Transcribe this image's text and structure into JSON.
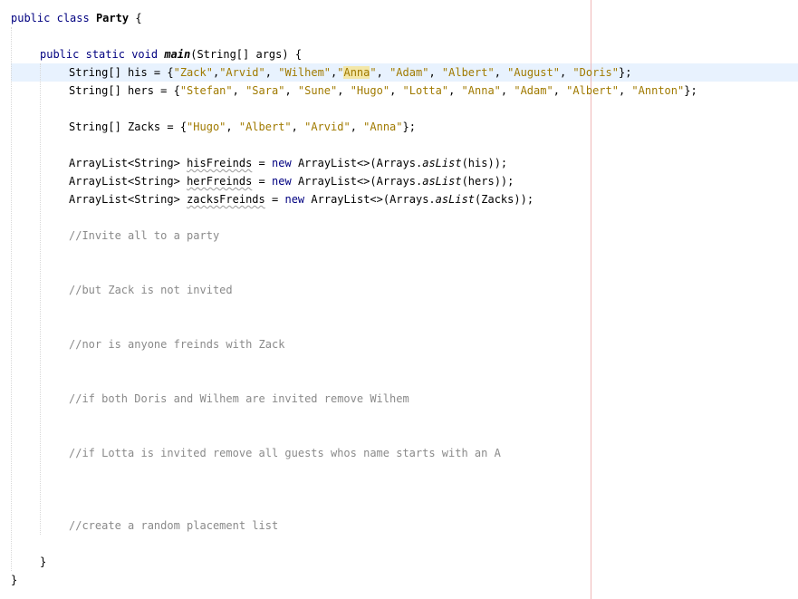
{
  "code": {
    "class_line": {
      "kw1": "public",
      "kw2": "class",
      "class_name": "Party",
      "open_brace": "{"
    },
    "main_line": {
      "kw_public": "public",
      "kw_static": "static",
      "kw_void": "void",
      "method_name": "main",
      "params": "(String[] args) {"
    },
    "his_line": {
      "decl": "String[] his = {",
      "items": [
        "\"Zack\"",
        "\"Arvid\"",
        "\"Wilhem\"",
        "\"Anna\"",
        "\"Adam\"",
        "\"Albert\"",
        "\"August\"",
        "\"Doris\""
      ],
      "close": "};"
    },
    "hers_line": {
      "decl": "String[] hers = {",
      "items": [
        "\"Stefan\"",
        "\"Sara\"",
        "\"Sune\"",
        "\"Hugo\"",
        "\"Lotta\"",
        "\"Anna\"",
        "\"Adam\"",
        "\"Albert\"",
        "\"Annton\""
      ],
      "close": "};"
    },
    "zacks_line": {
      "decl": "String[] Zacks = {",
      "items": [
        "\"Hugo\"",
        "\"Albert\"",
        "\"Arvid\"",
        "\"Anna\""
      ],
      "close": "};"
    },
    "list_lines": [
      {
        "type": "ArrayList<String>",
        "var": "hisFreinds",
        "eq": "=",
        "kw_new": "new",
        "ctor": "ArrayList<>(Arrays.",
        "method": "asList",
        "args": "(his));"
      },
      {
        "type": "ArrayList<String>",
        "var": "herFreinds",
        "eq": "=",
        "kw_new": "new",
        "ctor": "ArrayList<>(Arrays.",
        "method": "asList",
        "args": "(hers));"
      },
      {
        "type": "ArrayList<String>",
        "var": "zacksFreinds",
        "eq": "=",
        "kw_new": "new",
        "ctor": "ArrayList<>(Arrays.",
        "method": "asList",
        "args": "(Zacks));"
      }
    ],
    "comments": [
      "//Invite all to a party",
      "//but Zack is not invited",
      "//nor is anyone freinds with Zack",
      "//if both Doris and Wilhem are invited remove Wilhem",
      "//if Lotta is invited remove all guests whos name starts with an A",
      "//create a random placement list"
    ],
    "method_close": "}",
    "class_close": "}"
  },
  "colors": {
    "keyword": "#000080",
    "string": "#a07a00",
    "comment": "#8a8a8a",
    "highlight": "#f3e7a8",
    "current_line": "#e8f2fe",
    "margin_line": "#f0b8b8"
  }
}
